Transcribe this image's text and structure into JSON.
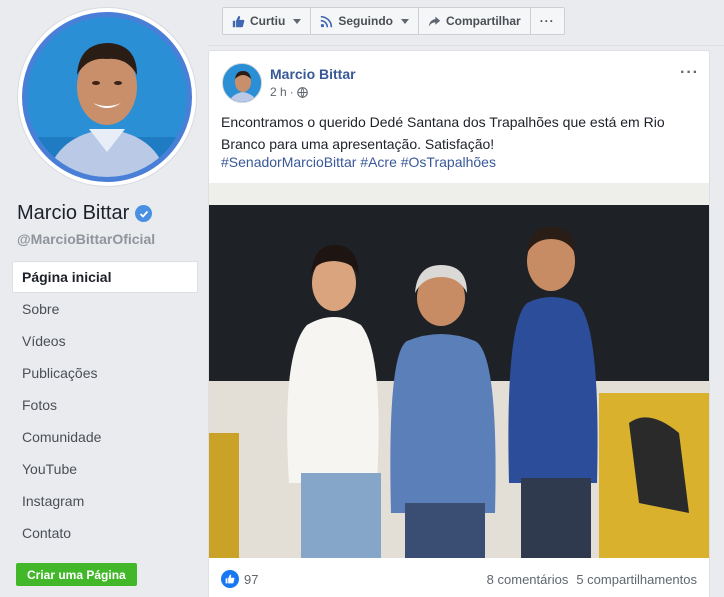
{
  "profile": {
    "name": "Marcio Bittar",
    "username": "@MarcioBittarOficial"
  },
  "nav": {
    "items": [
      {
        "label": "Página inicial"
      },
      {
        "label": "Sobre"
      },
      {
        "label": "Vídeos"
      },
      {
        "label": "Publicações"
      },
      {
        "label": "Fotos"
      },
      {
        "label": "Comunidade"
      },
      {
        "label": "YouTube"
      },
      {
        "label": "Instagram"
      },
      {
        "label": "Contato"
      }
    ],
    "create_page": "Criar uma Página"
  },
  "actions": {
    "like": "Curtiu",
    "follow": "Seguindo",
    "share": "Compartilhar",
    "more": "···"
  },
  "post": {
    "author": "Marcio Bittar",
    "time": "2 h",
    "separator": "·",
    "text": "Encontramos o querido Dedé Santana dos Trapalhões que está em Rio Branco para uma apresentação. Satisfação!",
    "hashtags": "#SenadorMarcioBittar #Acre #OsTrapalhões",
    "options": "···",
    "reactions": "97",
    "comments": "8 comentários",
    "shares": "5 compartilhamentos"
  },
  "colors": {
    "brand_blue": "#385898",
    "create_green": "#42b72a",
    "like_blue": "#1877f2"
  }
}
